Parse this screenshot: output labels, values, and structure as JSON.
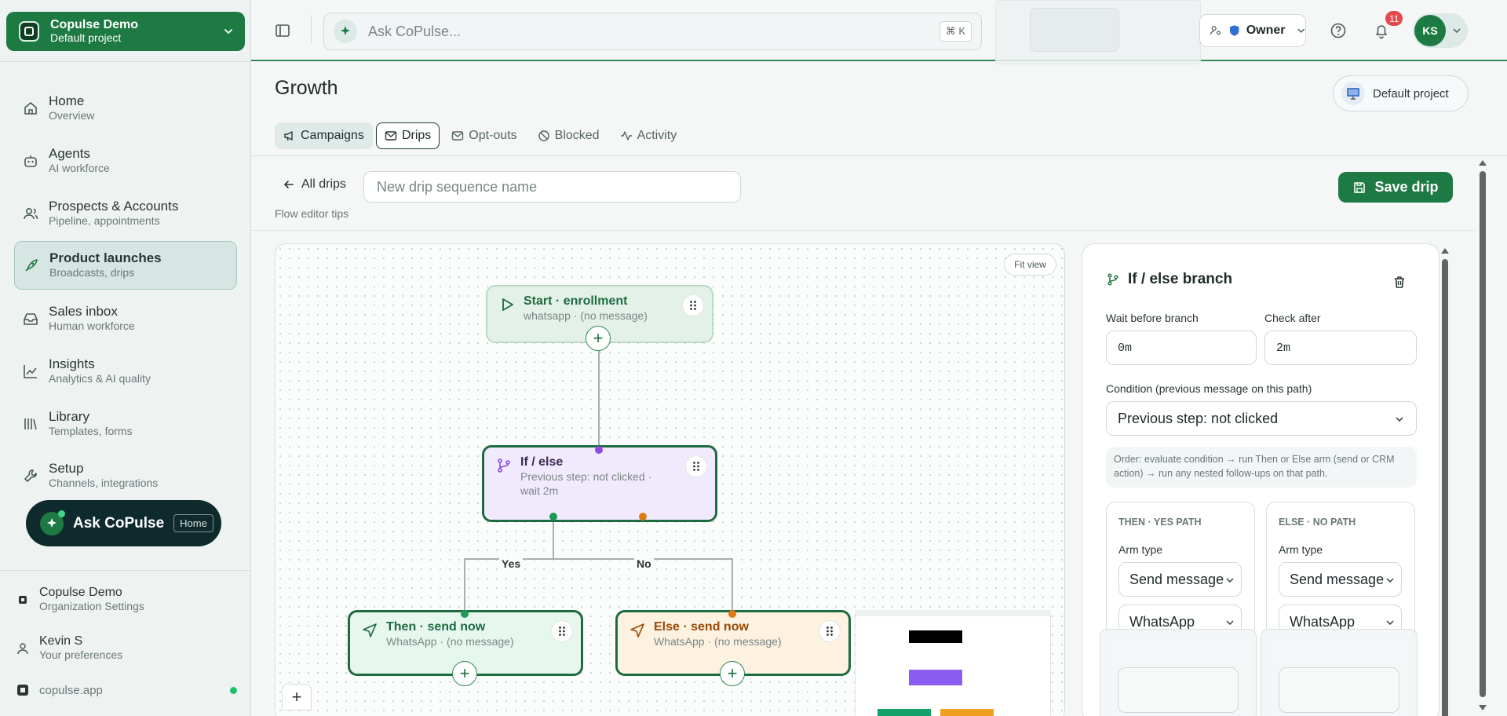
{
  "org": {
    "name": "Copulse Demo",
    "project": "Default project"
  },
  "nav": [
    {
      "label": "Home",
      "sub": "Overview",
      "icon": "home-icon"
    },
    {
      "label": "Agents",
      "sub": "AI workforce",
      "icon": "robot-icon"
    },
    {
      "label": "Prospects & Accounts",
      "sub": "Pipeline, appointments",
      "icon": "users-icon"
    },
    {
      "label": "Product launches",
      "sub": "Broadcasts, drips",
      "icon": "rocket-icon"
    },
    {
      "label": "Sales inbox",
      "sub": "Human workforce",
      "icon": "inbox-icon"
    },
    {
      "label": "Insights",
      "sub": "Analytics & AI quality",
      "icon": "chart-icon"
    },
    {
      "label": "Library",
      "sub": "Templates, forms",
      "icon": "library-icon"
    },
    {
      "label": "Setup",
      "sub": "Channels, integrations",
      "icon": "wrench-icon"
    }
  ],
  "ask": {
    "label": "Ask CoPulse",
    "context": "Home"
  },
  "footer": {
    "org_title": "Copulse Demo",
    "org_sub": "Organization Settings",
    "user_title": "Kevin S",
    "user_sub": "Your preferences",
    "domain": "copulse.app"
  },
  "topbar": {
    "search_placeholder": "Ask CoPulse...",
    "shortcut": "⌘ K",
    "role": "Owner",
    "notifications": "11",
    "avatar_initials": "KS"
  },
  "page": {
    "title": "Growth",
    "project_button": "Default project",
    "tabs": [
      "Campaigns",
      "Drips",
      "Opt-outs",
      "Blocked",
      "Activity"
    ]
  },
  "editor": {
    "back_label": "All drips",
    "name_placeholder": "New drip sequence name",
    "tips": "Flow editor tips",
    "save_label": "Save drip",
    "fit_view": "Fit view"
  },
  "nodes": {
    "start": {
      "title": "Start · enrollment",
      "sub": "whatsapp · (no message)"
    },
    "ifelse": {
      "title": "If / else",
      "sub1": "Previous step: not clicked ·",
      "sub2": "wait 2m"
    },
    "then": {
      "title": "Then · send now",
      "sub": "WhatsApp · (no message)"
    },
    "else": {
      "title": "Else · send now",
      "sub": "WhatsApp · (no message)"
    },
    "yes_label": "Yes",
    "no_label": "No"
  },
  "inspector": {
    "title": "If / else branch",
    "wait_label": "Wait before branch",
    "wait_value": "0m",
    "check_label": "Check after",
    "check_value": "2m",
    "condition_label": "Condition (previous message on this path)",
    "condition_value": "Previous step: not clicked",
    "hint": "Order: evaluate condition → run Then or Else arm (send or CRM action) → run any nested follow-ups on that path.",
    "then_arm": {
      "title": "THEN · YES PATH",
      "arm_type_label": "Arm type",
      "arm_type": "Send message",
      "channel": "WhatsApp"
    },
    "else_arm": {
      "title": "ELSE · NO PATH",
      "arm_type_label": "Arm type",
      "arm_type": "Send message",
      "channel": "WhatsApp"
    }
  },
  "colors": {
    "brand": "#1e7a43",
    "start_node": "#e3f1e8",
    "ifelse_node": "#f1eafd",
    "then_node": "#e6f7ee",
    "else_node": "#fdf1e0",
    "yes_port": "#1e9a55",
    "no_port": "#e07a14",
    "branch_port": "#8a4de0"
  }
}
